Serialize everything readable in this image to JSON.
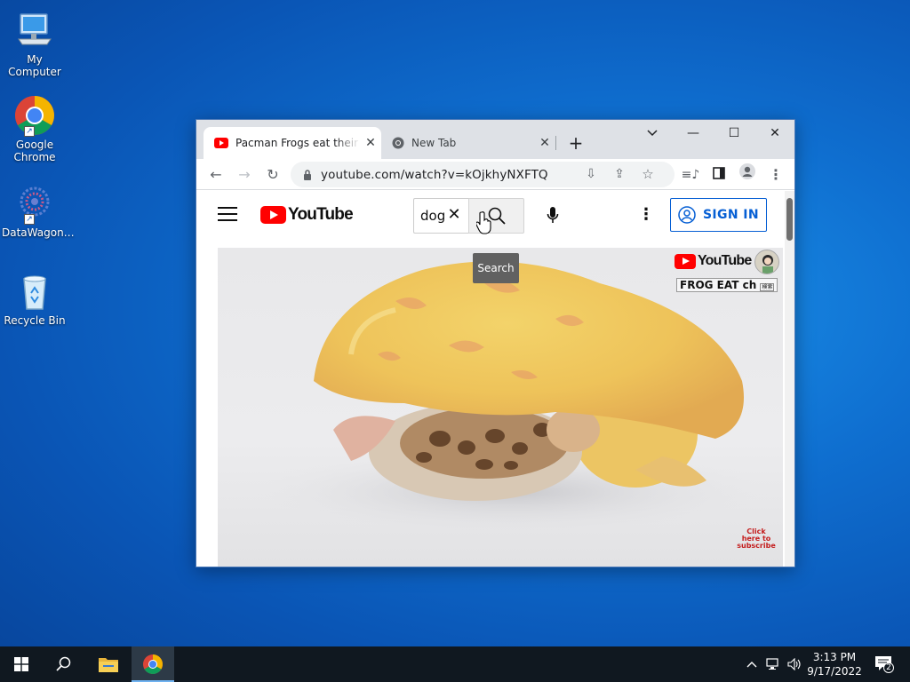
{
  "desktop": {
    "icons": [
      {
        "label": "My Computer"
      },
      {
        "label": "Google Chrome"
      },
      {
        "label": "DataWagon…"
      },
      {
        "label": "Recycle Bin"
      }
    ]
  },
  "browser": {
    "tabs": [
      {
        "title": "Pacman Frogs eat their young",
        "active": true
      },
      {
        "title": "New Tab",
        "active": false
      }
    ],
    "url": "youtube.com/watch?v=kOjkhyNXFTQ"
  },
  "youtube": {
    "logo_text": "YouTube",
    "search_value": "dog",
    "search_tooltip": "Search",
    "sign_in_label": "SIGN IN"
  },
  "video": {
    "watermark_logo_text": "YouTube",
    "watermark_channel": "FROG EAT ch",
    "watermark_small": "検索",
    "click_subscribe": "Click here to subscribe"
  },
  "taskbar": {
    "time": "3:13 PM",
    "date": "9/17/2022",
    "notification_count": "2"
  },
  "colors": {
    "youtube_red": "#ff0000",
    "signin_blue": "#065fd4",
    "taskbar": "#101820"
  }
}
